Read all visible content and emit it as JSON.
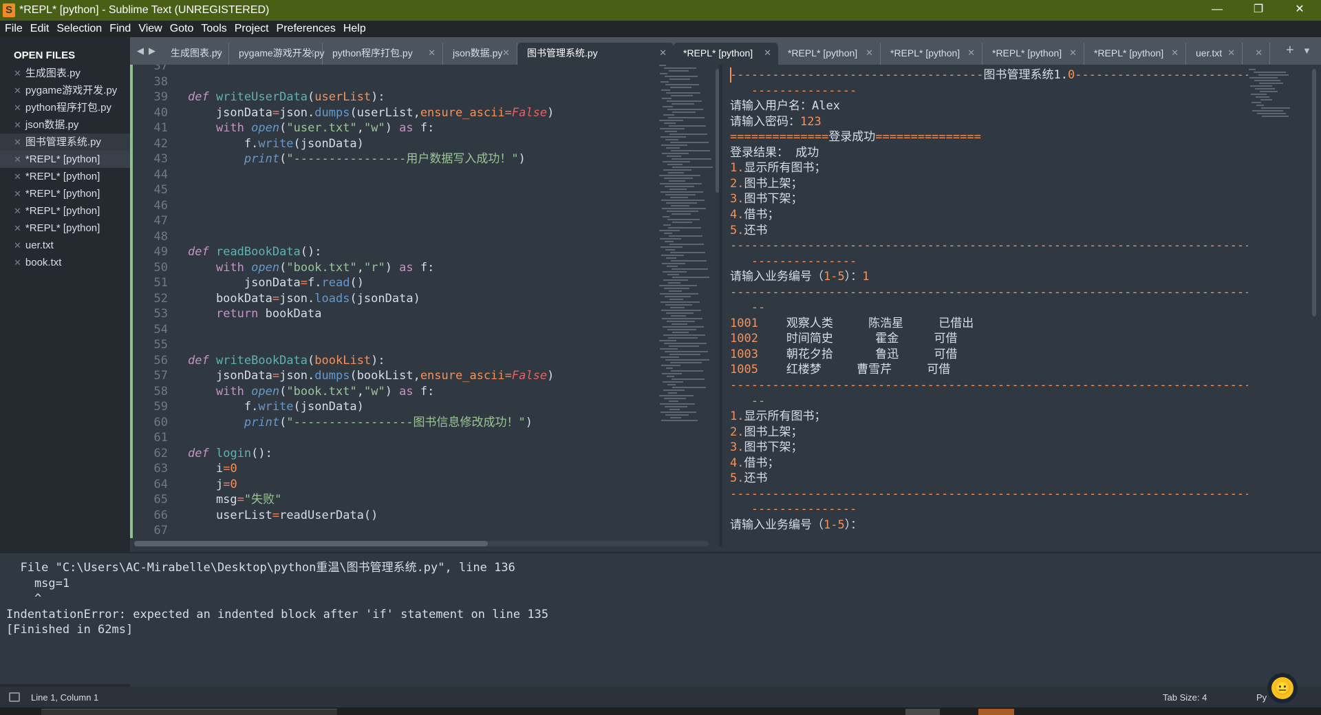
{
  "window": {
    "title": "*REPL* [python] - Sublime Text (UNREGISTERED)",
    "controls": [
      "—",
      "❐",
      "✕"
    ]
  },
  "menu": [
    "File",
    "Edit",
    "Selection",
    "Find",
    "View",
    "Goto",
    "Tools",
    "Project",
    "Preferences",
    "Help"
  ],
  "sidebar": {
    "heading": "OPEN FILES",
    "items": [
      {
        "label": "生成图表.py"
      },
      {
        "label": "pygame游戏开发.py"
      },
      {
        "label": "python程序打包.py"
      },
      {
        "label": "json数据.py"
      },
      {
        "label": "图书管理系统.py",
        "state": "hover"
      },
      {
        "label": "*REPL* [python]",
        "state": "active"
      },
      {
        "label": "*REPL* [python]"
      },
      {
        "label": "*REPL* [python]"
      },
      {
        "label": "*REPL* [python]"
      },
      {
        "label": "*REPL* [python]"
      },
      {
        "label": "uer.txt"
      },
      {
        "label": "book.txt"
      }
    ]
  },
  "tabs": [
    {
      "label": "生成图表.py"
    },
    {
      "label": "pygame游戏开发.py"
    },
    {
      "label": "python程序打包.py"
    },
    {
      "label": "json数据.py"
    },
    {
      "label": "图书管理系统.py",
      "active": true
    },
    {
      "label": "*REPL* [python]",
      "active": true
    },
    {
      "label": "*REPL* [python]"
    },
    {
      "label": "*REPL* [python]"
    },
    {
      "label": "*REPL* [python]"
    },
    {
      "label": "*REPL* [python]"
    },
    {
      "label": "uer.txt"
    },
    {
      "label": ""
    }
  ],
  "tab_close": "✕",
  "tab_nav": {
    "prev": "◀",
    "next": "▶",
    "add": "+",
    "more": "▼"
  },
  "editor": {
    "lines": [
      {
        "n": "37",
        "seg": []
      },
      {
        "n": "38",
        "seg": []
      },
      {
        "n": "39",
        "seg": [
          [
            "ki",
            "def"
          ],
          [
            "t",
            " "
          ],
          [
            "fn",
            "writeUserData"
          ],
          [
            "t",
            "("
          ],
          [
            "p",
            "userList"
          ],
          [
            "t",
            "):"
          ]
        ]
      },
      {
        "n": "40",
        "seg": [
          [
            "t",
            "    jsonData"
          ],
          [
            "op",
            "="
          ],
          [
            "t",
            "json."
          ],
          [
            "m",
            "dumps"
          ],
          [
            "t",
            "(userList,"
          ],
          [
            "p",
            "ensure_ascii"
          ],
          [
            "op",
            "="
          ],
          [
            "fa",
            "False"
          ],
          [
            "t",
            ")"
          ]
        ]
      },
      {
        "n": "41",
        "seg": [
          [
            "t",
            "    "
          ],
          [
            "k",
            "with"
          ],
          [
            "t",
            " "
          ],
          [
            "mi",
            "open"
          ],
          [
            "t",
            "("
          ],
          [
            "s",
            "\"user.txt\""
          ],
          [
            "t",
            ","
          ],
          [
            "s",
            "\"w\""
          ],
          [
            "t",
            ") "
          ],
          [
            "k",
            "as"
          ],
          [
            "t",
            " f:"
          ]
        ]
      },
      {
        "n": "42",
        "seg": [
          [
            "t",
            "        f."
          ],
          [
            "m",
            "write"
          ],
          [
            "t",
            "(jsonData)"
          ]
        ]
      },
      {
        "n": "43",
        "seg": [
          [
            "t",
            "        "
          ],
          [
            "mi",
            "print"
          ],
          [
            "t",
            "("
          ],
          [
            "s",
            "\"----------------用户数据写入成功！\""
          ],
          [
            "t",
            ")"
          ]
        ]
      },
      {
        "n": "44",
        "seg": []
      },
      {
        "n": "45",
        "seg": []
      },
      {
        "n": "46",
        "seg": []
      },
      {
        "n": "47",
        "seg": []
      },
      {
        "n": "48",
        "seg": []
      },
      {
        "n": "49",
        "seg": [
          [
            "ki",
            "def"
          ],
          [
            "t",
            " "
          ],
          [
            "fn",
            "readBookData"
          ],
          [
            "t",
            "():"
          ]
        ]
      },
      {
        "n": "50",
        "seg": [
          [
            "t",
            "    "
          ],
          [
            "k",
            "with"
          ],
          [
            "t",
            " "
          ],
          [
            "mi",
            "open"
          ],
          [
            "t",
            "("
          ],
          [
            "s",
            "\"book.txt\""
          ],
          [
            "t",
            ","
          ],
          [
            "s",
            "\"r\""
          ],
          [
            "t",
            ") "
          ],
          [
            "k",
            "as"
          ],
          [
            "t",
            " f:"
          ]
        ]
      },
      {
        "n": "51",
        "seg": [
          [
            "t",
            "        jsonData"
          ],
          [
            "op",
            "="
          ],
          [
            "t",
            "f."
          ],
          [
            "m",
            "read"
          ],
          [
            "t",
            "()"
          ]
        ]
      },
      {
        "n": "52",
        "seg": [
          [
            "t",
            "    bookData"
          ],
          [
            "op",
            "="
          ],
          [
            "t",
            "json."
          ],
          [
            "m",
            "loads"
          ],
          [
            "t",
            "(jsonData)"
          ]
        ]
      },
      {
        "n": "53",
        "seg": [
          [
            "t",
            "    "
          ],
          [
            "k",
            "return"
          ],
          [
            "t",
            " bookData"
          ]
        ]
      },
      {
        "n": "54",
        "seg": []
      },
      {
        "n": "55",
        "seg": []
      },
      {
        "n": "56",
        "seg": [
          [
            "ki",
            "def"
          ],
          [
            "t",
            " "
          ],
          [
            "fn",
            "writeBookData"
          ],
          [
            "t",
            "("
          ],
          [
            "p",
            "bookList"
          ],
          [
            "t",
            "):"
          ]
        ]
      },
      {
        "n": "57",
        "seg": [
          [
            "t",
            "    jsonData"
          ],
          [
            "op",
            "="
          ],
          [
            "t",
            "json."
          ],
          [
            "m",
            "dumps"
          ],
          [
            "t",
            "(bookList,"
          ],
          [
            "p",
            "ensure_ascii"
          ],
          [
            "op",
            "="
          ],
          [
            "fa",
            "False"
          ],
          [
            "t",
            ")"
          ]
        ]
      },
      {
        "n": "58",
        "seg": [
          [
            "t",
            "    "
          ],
          [
            "k",
            "with"
          ],
          [
            "t",
            " "
          ],
          [
            "mi",
            "open"
          ],
          [
            "t",
            "("
          ],
          [
            "s",
            "\"book.txt\""
          ],
          [
            "t",
            ","
          ],
          [
            "s",
            "\"w\""
          ],
          [
            "t",
            ") "
          ],
          [
            "k",
            "as"
          ],
          [
            "t",
            " f:"
          ]
        ]
      },
      {
        "n": "59",
        "seg": [
          [
            "t",
            "        f."
          ],
          [
            "m",
            "write"
          ],
          [
            "t",
            "(jsonData)"
          ]
        ]
      },
      {
        "n": "60",
        "seg": [
          [
            "t",
            "        "
          ],
          [
            "mi",
            "print"
          ],
          [
            "t",
            "("
          ],
          [
            "s",
            "\"-----------------图书信息修改成功！\""
          ],
          [
            "t",
            ")"
          ]
        ]
      },
      {
        "n": "61",
        "seg": []
      },
      {
        "n": "62",
        "seg": [
          [
            "ki",
            "def"
          ],
          [
            "t",
            " "
          ],
          [
            "fn",
            "login"
          ],
          [
            "t",
            "():"
          ]
        ]
      },
      {
        "n": "63",
        "seg": [
          [
            "t",
            "    i"
          ],
          [
            "op",
            "="
          ],
          [
            "n",
            "0"
          ]
        ]
      },
      {
        "n": "64",
        "seg": [
          [
            "t",
            "    j"
          ],
          [
            "op",
            "="
          ],
          [
            "n",
            "0"
          ]
        ]
      },
      {
        "n": "65",
        "seg": [
          [
            "t",
            "    msg"
          ],
          [
            "op",
            "="
          ],
          [
            "s",
            "\"失败\""
          ]
        ]
      },
      {
        "n": "66",
        "seg": [
          [
            "t",
            "    userList"
          ],
          [
            "op",
            "="
          ],
          [
            "t",
            "readUserData()"
          ]
        ]
      },
      {
        "n": "67",
        "seg": []
      }
    ]
  },
  "repl": {
    "lines": [
      [
        [
          "o",
          "------------------------------------"
        ],
        [
          "t",
          "图书管理系统1."
        ],
        [
          "o",
          "0------------------------------------------"
        ]
      ],
      [
        [
          "o",
          "   ---------------"
        ]
      ],
      [
        [
          "t",
          "请输入用户名：Alex"
        ]
      ],
      [
        [
          "t",
          "请输入密码："
        ],
        [
          "o",
          "123"
        ]
      ],
      [
        [
          "o",
          "=============="
        ],
        [
          "t",
          "登录成功"
        ],
        [
          "o",
          "==============="
        ]
      ],
      [
        [
          "t",
          "登录结果： 成功"
        ]
      ],
      [
        [
          "o",
          "1."
        ],
        [
          "t",
          "显示所有图书；"
        ]
      ],
      [
        [
          "o",
          "2."
        ],
        [
          "t",
          "图书上架；"
        ]
      ],
      [
        [
          "o",
          "3."
        ],
        [
          "t",
          "图书下架；"
        ]
      ],
      [
        [
          "o",
          "4."
        ],
        [
          "t",
          "借书；"
        ]
      ],
      [
        [
          "o",
          "5."
        ],
        [
          "t",
          "还书"
        ]
      ],
      [
        [
          "o",
          "------------------------------------------------------------------------------"
        ]
      ],
      [
        [
          "o",
          "   ---------------"
        ]
      ],
      [
        [
          "t",
          "请输入业务编号（"
        ],
        [
          "o",
          "1-5"
        ],
        [
          "t",
          "）："
        ],
        [
          "o",
          "1"
        ]
      ],
      [
        [
          "o",
          "------------------------------------------------------------------------------"
        ]
      ],
      [
        [
          "o",
          "   --"
        ]
      ],
      [
        [
          "o",
          "1001"
        ],
        [
          "t",
          "    观察人类     陈浩星     已借出"
        ]
      ],
      [
        [
          "o",
          "1002"
        ],
        [
          "t",
          "    时间简史      霍金     可借"
        ]
      ],
      [
        [
          "o",
          "1003"
        ],
        [
          "t",
          "    朝花夕拾      鲁迅     可借"
        ]
      ],
      [
        [
          "o",
          "1005"
        ],
        [
          "t",
          "    红楼梦     曹雪芹     可借"
        ]
      ],
      [
        [
          "o",
          "------------------------------------------------------------------------------"
        ]
      ],
      [
        [
          "o",
          "   --"
        ]
      ],
      [
        [
          "o",
          "1."
        ],
        [
          "t",
          "显示所有图书；"
        ]
      ],
      [
        [
          "o",
          "2."
        ],
        [
          "t",
          "图书上架；"
        ]
      ],
      [
        [
          "o",
          "3."
        ],
        [
          "t",
          "图书下架；"
        ]
      ],
      [
        [
          "o",
          "4."
        ],
        [
          "t",
          "借书；"
        ]
      ],
      [
        [
          "o",
          "5."
        ],
        [
          "t",
          "还书"
        ]
      ],
      [
        [
          "o",
          "------------------------------------------------------------------------------"
        ]
      ],
      [
        [
          "o",
          "   ---------------"
        ]
      ],
      [
        [
          "t",
          "请输入业务编号（"
        ],
        [
          "o",
          "1-5"
        ],
        [
          "t",
          "）："
        ]
      ]
    ]
  },
  "output": {
    "lines": [
      "  File \"C:\\Users\\AC-Mirabelle\\Desktop\\python重温\\图书管理系统.py\", line 136",
      "    msg=1",
      "    ^",
      "IndentationError: expected an indented block after 'if' statement on line 135",
      "[Finished in 62ms]"
    ]
  },
  "status": {
    "position": "Line 1, Column 1",
    "tab_size": "Tab Size: 4",
    "syntax": "Py"
  },
  "colors": {
    "titlebar": "#4a5f16",
    "background": "#303841",
    "accent_orange": "#f99157",
    "gutter_modified": "#8fc18f"
  }
}
